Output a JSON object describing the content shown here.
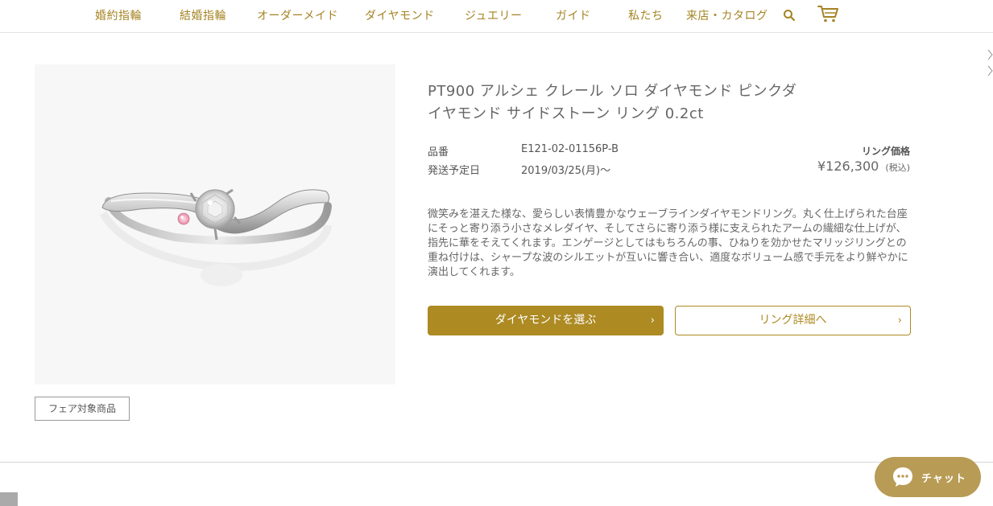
{
  "nav": {
    "items": [
      {
        "label": "婚約指輪"
      },
      {
        "label": "結婚指輪"
      },
      {
        "label": "オーダーメイド"
      },
      {
        "label": "ダイヤモンド"
      },
      {
        "label": "ジュエリー"
      },
      {
        "label": "ガイド"
      },
      {
        "label": "私たち"
      },
      {
        "label": "来店・カタログ"
      }
    ],
    "icons": [
      "search-icon",
      "cart-icon"
    ]
  },
  "product": {
    "title": "PT900 アルシェ クレール ソロ ダイヤモンド ピンクダイヤモンド サイドストーン リング 0.2ct",
    "specs": [
      {
        "label": "品番",
        "value": "E121-02-01156P-B"
      },
      {
        "label": "発送予定日",
        "value": "2019/03/25(月)〜"
      }
    ],
    "price_label": "リング価格",
    "price": "¥126,300",
    "tax_note": "(税込)",
    "description": "微笑みを湛えた様な、愛らしい表情豊かなウェーブラインダイヤモンドリング。丸く仕上げられた台座にそっと寄り添う小さなメレダイヤ、そしてさらに寄り添う様に支えられたアームの繊細な仕上げが、指先に華をそえてくれます。エンゲージとしてはもちろんの事、ひねりを効かせたマリッジリングとの重ね付けは、シャープな波のシルエットが互いに響き合い、適度なボリューム感で手元をより鮮やかに演出してくれます。",
    "badge": "フェア対象商品"
  },
  "buttons": {
    "primary": "ダイヤモンドを選ぶ",
    "secondary": "リング詳細へ",
    "arrow": "›"
  },
  "chat": {
    "label": "チャット"
  },
  "colors": {
    "accent": "#ad8a22",
    "nav_text": "#a58424",
    "chat_bg": "#b89b55"
  }
}
